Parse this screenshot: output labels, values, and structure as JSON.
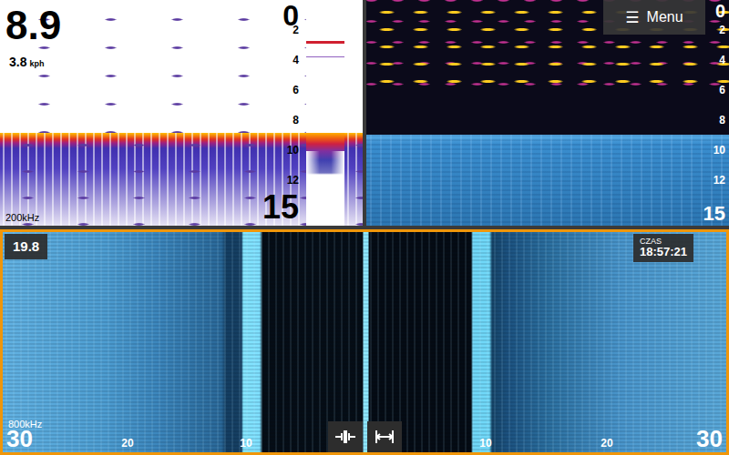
{
  "sonar": {
    "active": false,
    "depth": "8.9",
    "speed": "3.8",
    "speed_unit": "kph",
    "frequency": "200kHz",
    "scale_top": "0",
    "scale_ticks": [
      "2",
      "4",
      "6",
      "8",
      "10",
      "12"
    ],
    "scale_bottom": "15"
  },
  "downscan": {
    "active": false,
    "menu": {
      "icon": "☰",
      "label": "Menu"
    },
    "scale_top": "0",
    "scale_ticks": [
      "2",
      "4",
      "6",
      "8",
      "10",
      "12"
    ],
    "scale_bottom": "15"
  },
  "sidescan": {
    "active": true,
    "depth": "19.8",
    "clock": {
      "label": "CZAS",
      "time": "18:57:21"
    },
    "frequency": "800kHz",
    "range_left": "30",
    "ticks_left": [
      "20",
      "10"
    ],
    "ticks_right": [
      "10",
      "20"
    ],
    "range_right": "30"
  }
}
